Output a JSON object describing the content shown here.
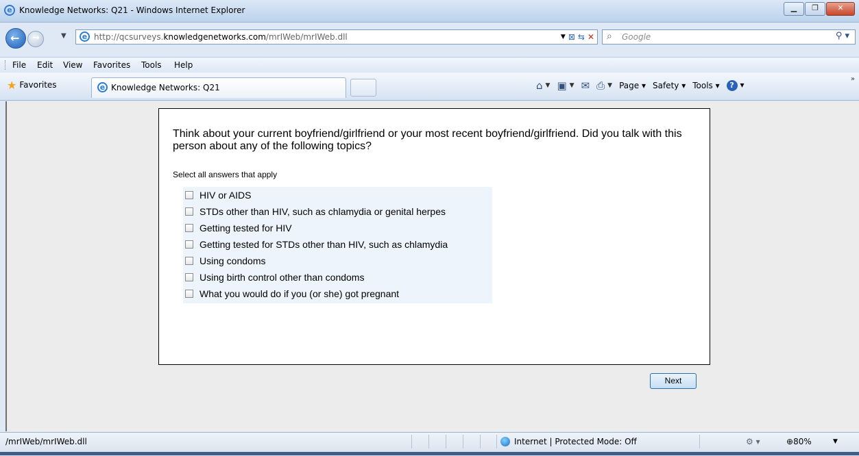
{
  "window": {
    "title": "Knowledge Networks: Q21 - Windows Internet Explorer",
    "controls": [
      "minimize",
      "maximize",
      "close"
    ]
  },
  "addressbar": {
    "url_prefix": "http://qcsurveys.",
    "url_domain": "knowledgenetworks.com",
    "url_path": "/mrIWeb/mrIWeb.dll",
    "search_placeholder": "Google"
  },
  "menubar": {
    "items": [
      "File",
      "Edit",
      "View",
      "Favorites",
      "Tools",
      "Help"
    ]
  },
  "favbar": {
    "favorites_label": "Favorites",
    "tab_label": "Knowledge Networks: Q21",
    "commands": {
      "page": "Page",
      "safety": "Safety",
      "tools": "Tools"
    }
  },
  "survey": {
    "question": "Think about your current boyfriend/girlfriend or your most recent boyfriend/girlfriend. Did you talk with this person about any of the following topics?",
    "instruction": "Select all answers that apply",
    "options": [
      "HIV or AIDS",
      "STDs other than HIV, such as chlamydia or genital herpes",
      "Getting tested for HIV",
      "Getting tested for STDs other than HIV, such as chlamydia",
      "Using condoms",
      "Using birth control other than condoms",
      "What you would do if you (or she) got pregnant"
    ],
    "next_label": "Next"
  },
  "statusbar": {
    "status_text": "/mrIWeb/mrIWeb.dll",
    "zone_text": "Internet | Protected Mode: Off",
    "zoom": "80%"
  }
}
